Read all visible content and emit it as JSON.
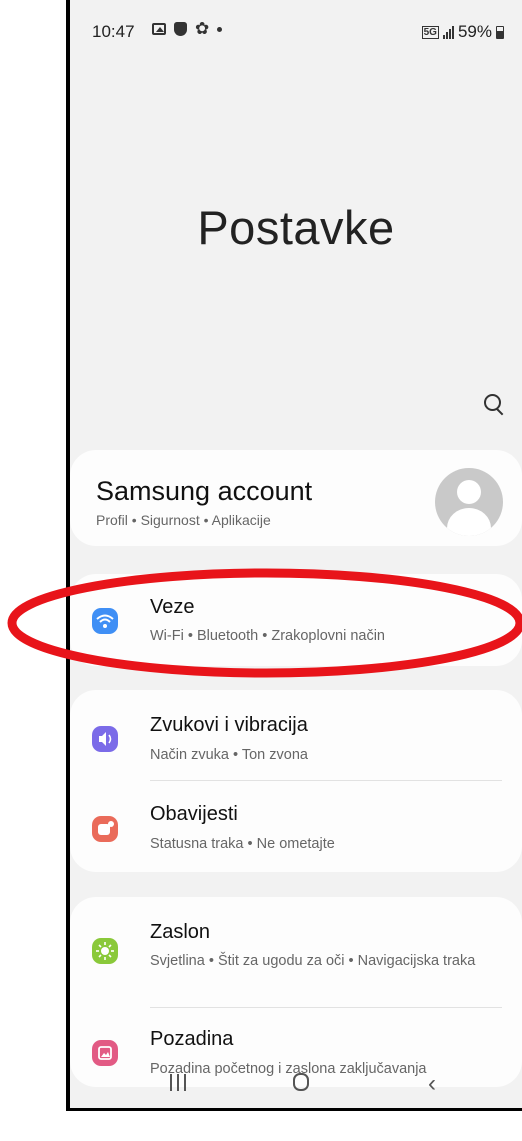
{
  "status_bar": {
    "time": "10:47",
    "icons": [
      "gallery-icon",
      "shield-icon",
      "gear-icon",
      "dot-icon"
    ],
    "network_badge": "5G",
    "battery_percent": "59%"
  },
  "header": {
    "title": "Postavke",
    "search_icon": "search-icon"
  },
  "account": {
    "title": "Samsung account",
    "subtitle": "Profil • Sigurnost • Aplikacije"
  },
  "settings_groups": [
    {
      "items": [
        {
          "title": "Veze",
          "subtitle": "Wi-Fi • Bluetooth • Zrakoplovni način",
          "icon": "wifi-icon",
          "color": "#3f8ff5"
        }
      ]
    },
    {
      "items": [
        {
          "title": "Zvukovi i vibracija",
          "subtitle": "Način zvuka • Ton zvona",
          "icon": "sound-icon",
          "color": "#7b6be8"
        },
        {
          "title": "Obavijesti",
          "subtitle": "Statusna traka • Ne ometajte",
          "icon": "notification-icon",
          "color": "#ea6b5a"
        }
      ]
    },
    {
      "items": [
        {
          "title": "Zaslon",
          "subtitle": "Svjetlina • Štit za ugodu za oči • Navigacijska traka",
          "icon": "display-icon",
          "color": "#8ac93a"
        },
        {
          "title": "Pozadina",
          "subtitle": "Pozadina početnog i zaslona zaključavanja",
          "icon": "wallpaper-icon",
          "color": "#e25a84"
        }
      ]
    }
  ],
  "highlight": {
    "color": "#e8141a",
    "target": "Veze"
  },
  "nav_bar": {
    "buttons": [
      "recent-apps-button",
      "home-button",
      "back-button"
    ]
  }
}
